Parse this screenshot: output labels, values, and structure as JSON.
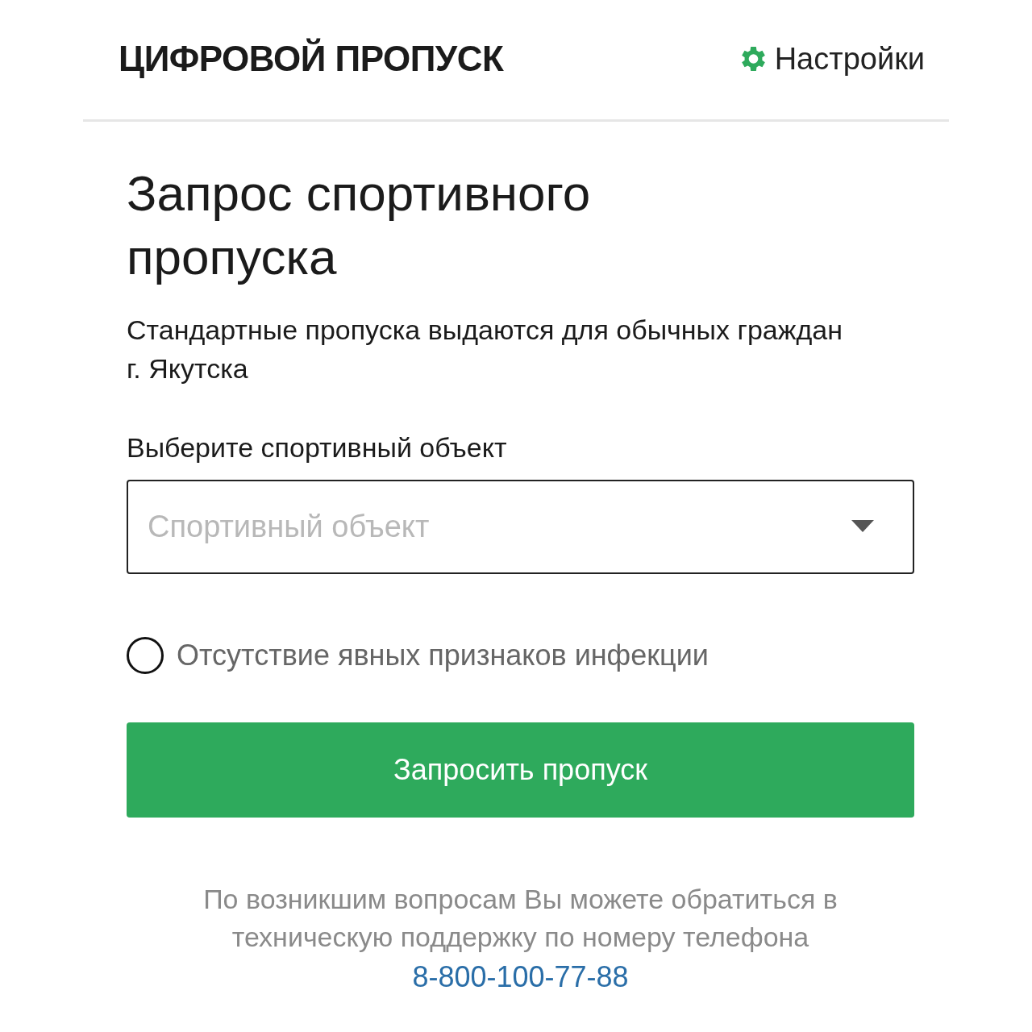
{
  "header": {
    "title": "ЦИФРОВОЙ ПРОПУСК",
    "settings": "Настройки"
  },
  "heading": "Запрос спортивного пропуска",
  "description": "Стандартные пропуска выдаются для обычных граждан г. Якутска",
  "facility": {
    "label": "Выберите спортивный объект",
    "placeholder": "Спортивный объект"
  },
  "symptoms_check": {
    "label": "Отсутствие явных признаков инфекции",
    "checked": false
  },
  "submit": "Запросить пропуск",
  "support": {
    "text": "По возникшим вопросам Вы можете обратиться в техническую поддержку по номеру телефона",
    "phone": "8-800-100-77-88"
  }
}
